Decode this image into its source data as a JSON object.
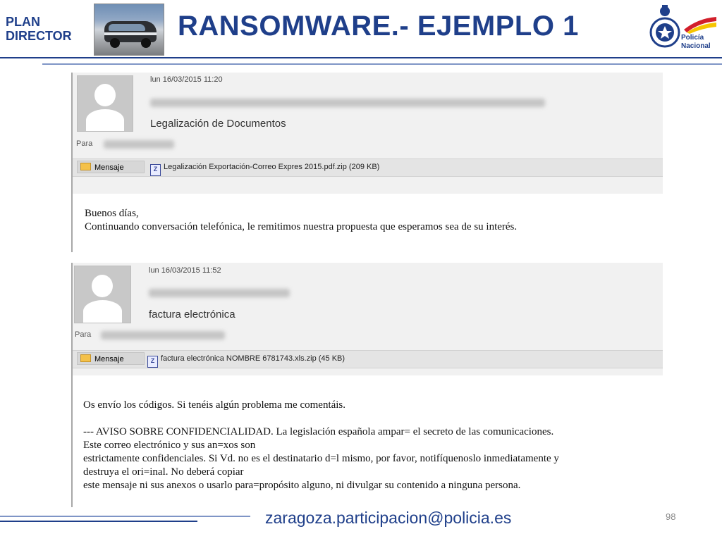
{
  "header": {
    "plan_line1": "PLAN",
    "plan_line2": "DIRECTOR",
    "title": "RANSOMWARE.- EJEMPLO 1",
    "police_line1": "Policía",
    "police_line2": "Nacional"
  },
  "email1": {
    "date": "lun 16/03/2015 11:20",
    "subject": "Legalización de Documentos",
    "to_label": "Para",
    "tab_label": "Mensaje",
    "attachment": "Legalización Exportación-Correo Expres 2015.pdf.zip (209 KB)",
    "body": [
      "Buenos días,",
      "Continuando conversación telefónica, le remitimos nuestra propuesta que esperamos sea de su interés."
    ]
  },
  "email2": {
    "date": "lun 16/03/2015 11:52",
    "subject": "factura electrónica",
    "to_label": "Para",
    "tab_label": "Mensaje",
    "attachment": "factura electrónica NOMBRE 6781743.xls.zip (45 KB)",
    "body": [
      "Os envío los códigos. Si tenéis algún problema me comentáis.",
      "",
      "--- AVISO SOBRE CONFIDENCIALIDAD. La legislación española ampar= el secreto de las comunicaciones.",
      "Este correo electrónico y sus an=xos son",
      "estrictamente confidenciales. Si Vd. no es el destinatario d=l mismo, por favor, notifíquenoslo inmediatamente y",
      "destruya el ori=inal. No deberá copiar",
      "este mensaje ni sus anexos o usarlo para=propósito alguno, ni divulgar su contenido a ninguna persona."
    ]
  },
  "footer": {
    "email": "zaragoza.participacion@policia.es",
    "page": "98"
  },
  "colors": {
    "brand_blue": "#1f3f8a",
    "accent_blue": "#7f95c6"
  },
  "icons": [
    "police-car-photo",
    "police-badge-icon",
    "avatar-icon",
    "envelope-icon",
    "zip-file-icon"
  ]
}
